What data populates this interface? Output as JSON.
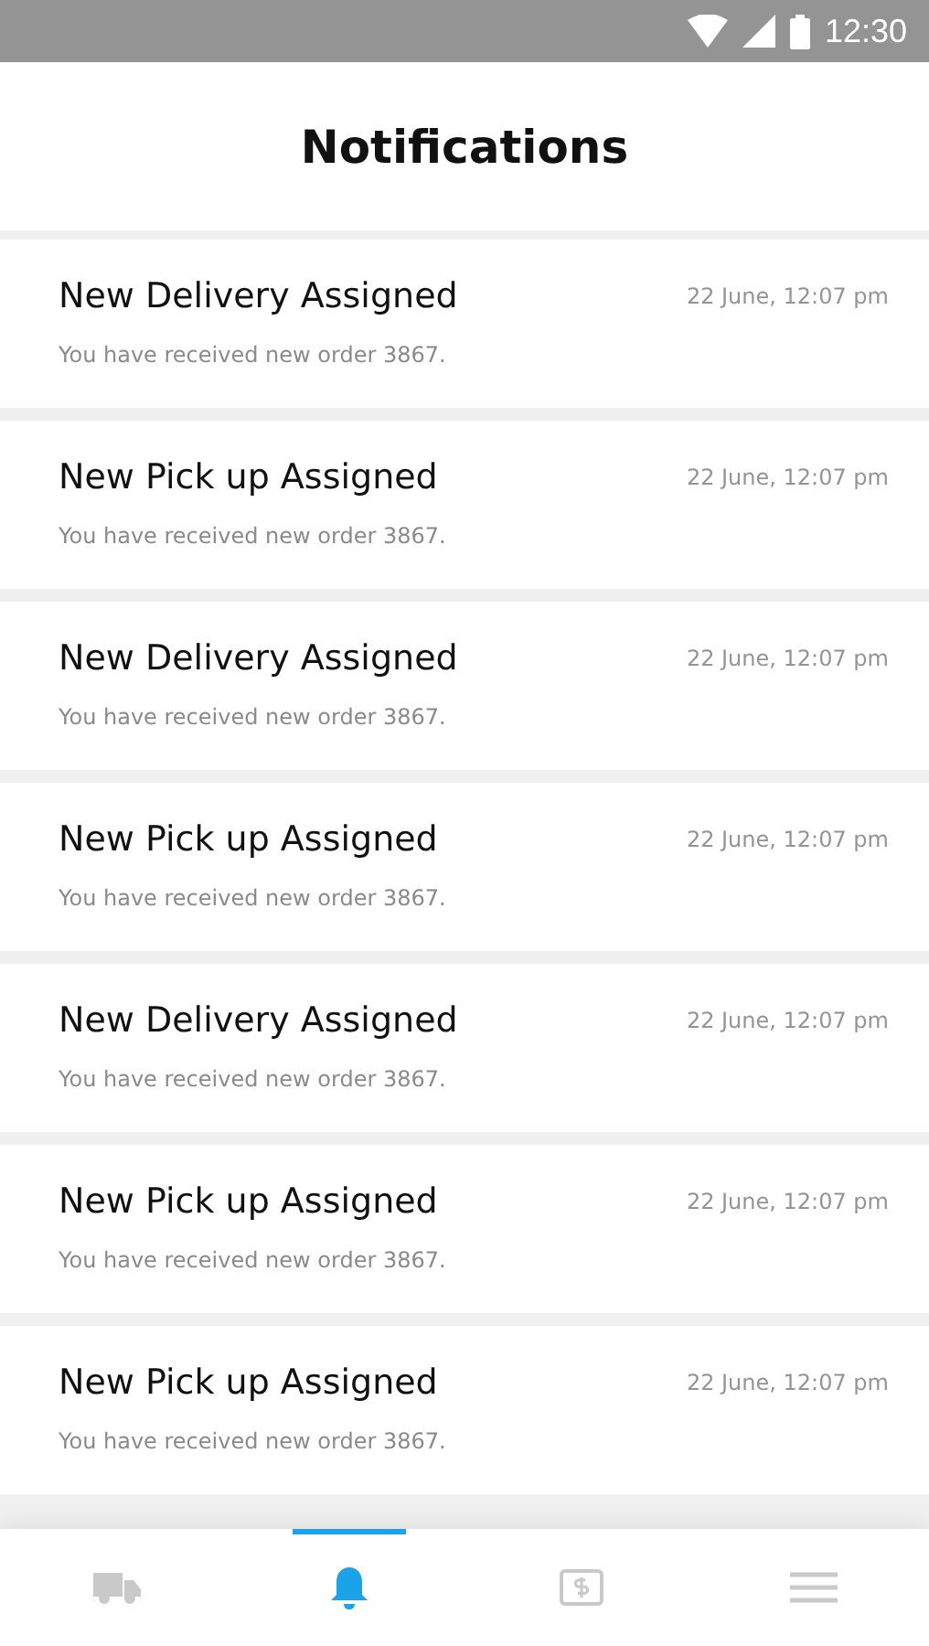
{
  "status_bar": {
    "time": "12:30"
  },
  "header": {
    "title": "Notifications"
  },
  "notifications": [
    {
      "title": "New Delivery Assigned",
      "time": "22 June, 12:07 pm",
      "message": "You have received new order 3867."
    },
    {
      "title": "New Pick up Assigned",
      "time": "22 June, 12:07 pm",
      "message": "You have received new order 3867."
    },
    {
      "title": "New Delivery Assigned",
      "time": "22 June, 12:07 pm",
      "message": "You have received new order 3867."
    },
    {
      "title": "New Pick up Assigned",
      "time": "22 June, 12:07 pm",
      "message": "You have received new order 3867."
    },
    {
      "title": "New Delivery Assigned",
      "time": "22 June, 12:07 pm",
      "message": "You have received new order 3867."
    },
    {
      "title": "New Pick up Assigned",
      "time": "22 June, 12:07 pm",
      "message": "You have received new order 3867."
    },
    {
      "title": "New Pick up Assigned",
      "time": "22 June, 12:07 pm",
      "message": "You have received new order 3867."
    }
  ],
  "bottom_nav": [
    {
      "kind": "truck",
      "selected": false
    },
    {
      "kind": "bell",
      "selected": true
    },
    {
      "kind": "cash",
      "selected": false
    },
    {
      "kind": "menu",
      "selected": false
    }
  ]
}
